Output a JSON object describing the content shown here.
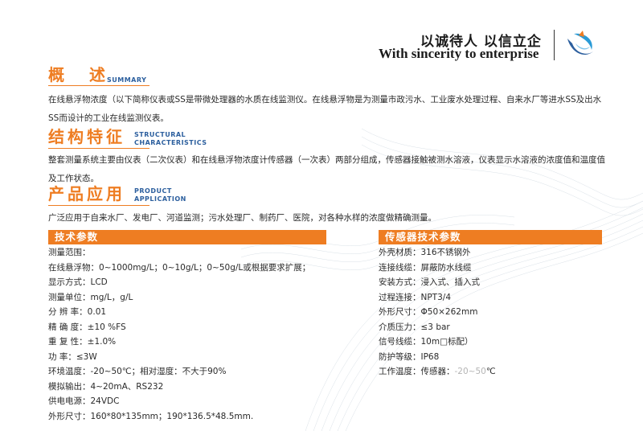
{
  "header": {
    "slogan_cn": "以诚待人  以信立企",
    "slogan_en": "With sincerity to enterprise",
    "logo_icon": "wave-swirl-logo",
    "brand_colors": {
      "orange": "#ee7d22",
      "blue": "#2c5f9e",
      "light_blue": "#2a9bd7"
    }
  },
  "overview": {
    "title": "概  述",
    "title_en": "SUMMARY",
    "text": "在线悬浮物浓度（以下简称仪表或SS是带微处理器的水质在线监测仪。在线悬浮物是为测量市政污水、工业废水处理过程、自来水厂等进水SS及出水SS而设计的工业在线监测仪表。"
  },
  "structure": {
    "title": "结构特征",
    "title_en_line1": "STRUCTURAL",
    "title_en_line2": "CHARACTERISTICS",
    "text": "整套测量系统主要由仪表（二次仪表）和在线悬浮物浓度计传感器（一次表）两部分组成，传感器接触被测水溶液，仪表显示水溶液的浓度值和温度值及工作状态。"
  },
  "application": {
    "title": "产品应用",
    "title_en_line1": "PRODUCT",
    "title_en_line2": "APPLICATION",
    "text": "广泛应用于自来水厂、发电厂、河道监测；污水处理厂、制药厂、医院，对各种水样的浓度做精确测量。"
  },
  "tech_params": {
    "title": "技术参数",
    "rows": [
      "测量范围：",
      "在线悬浮物：0~1000mg/L；0~10g/L；0~50g/L或根据要求扩展；",
      "显示方式：LCD",
      "测量单位：mg/L，g/L",
      "分 辨 率：0.01",
      "精 确 度：±10 %FS",
      "重 复 性：±1.0%",
      "功    率：≤3W",
      "环境温度：-20~50℃；相对湿度：不大于90%",
      "模拟输出：4~20mA、RS232",
      "供电电源：24VDC",
      "外形尺寸：160*80*135mm；190*136.5*48.5mm."
    ]
  },
  "sensor_params": {
    "title": "传感器技术参数",
    "rows": [
      "外壳材质：316不锈钢外",
      "连接线缆：屏蔽防水线缆",
      "安装方式：浸入式、插入式",
      "过程连接：NPT3/4",
      "外形尺寸：Φ50×262mm",
      "介质压力：≤3 bar",
      "信号线缆：10m□标配）",
      "防护等级：IP68"
    ],
    "last_row_prefix": "工作温度：传感器：",
    "last_row_range": "-20~50",
    "last_row_unit": "℃"
  }
}
